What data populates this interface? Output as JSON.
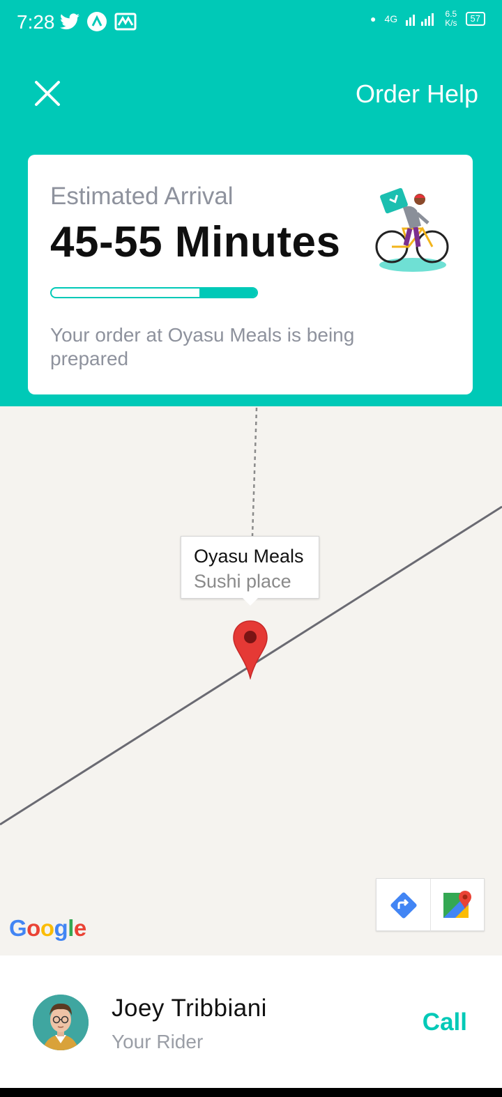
{
  "status_bar": {
    "time": "7:28",
    "network": "4G",
    "speed_value": "6.5",
    "speed_unit": "K/s",
    "battery": "57"
  },
  "header": {
    "close_icon": "close-icon",
    "order_help_label": "Order Help"
  },
  "arrival_card": {
    "label": "Estimated Arrival",
    "time_range": "45-55 Minutes",
    "progress_fraction": 0.28,
    "status_text": "Your order at Oyasu Meals is being prepared",
    "illustration": "delivery-rider-on-bike"
  },
  "map": {
    "marker_title": "Oyasu Meals",
    "marker_subtitle": "Sushi place",
    "logo_text": "Google",
    "directions_icon": "directions-icon",
    "open_maps_icon": "google-maps-icon"
  },
  "rider": {
    "name": "Joey Tribbiani",
    "role": "Your Rider",
    "call_label": "Call"
  },
  "colors": {
    "brand": "#00c9b7",
    "text_muted": "#8e929d",
    "pin": "#e53935"
  }
}
